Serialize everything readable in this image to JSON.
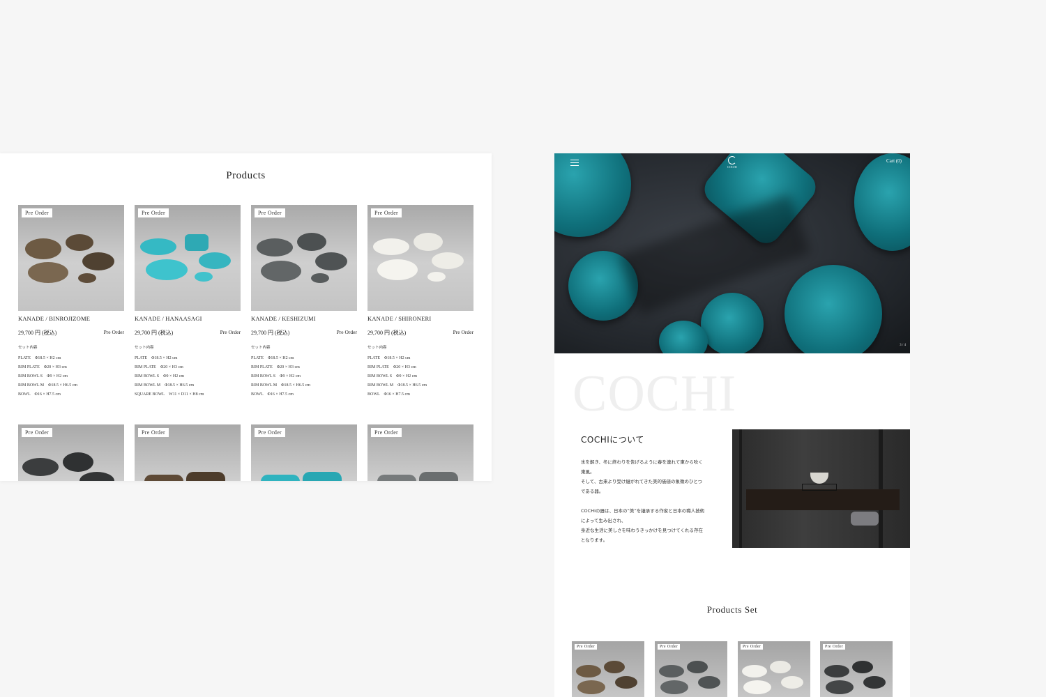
{
  "products_section": {
    "title": "Products",
    "items": [
      {
        "badge": "Pre Order",
        "name": "KANADE / BINROJIZOME",
        "price": "29,700 円 (税込)",
        "status": "Pre Order",
        "set_label": "セット内容",
        "specs": [
          "PLATE　Φ18.5 × H2 cm",
          "RIM PLATE　Φ20 × H3 cm",
          "RIM BOWL S　Φ9 × H2 cm",
          "RIM BOWL M　Φ18.5 × H6.5 cm",
          "BOWL　Φ16 × H7.5 cm"
        ],
        "color": "#6d5a43"
      },
      {
        "badge": "Pre Order",
        "name": "KANADE / HANAASAGI",
        "price": "29,700 円 (税込)",
        "status": "Pre Order",
        "set_label": "セット内容",
        "specs": [
          "PLATE　Φ18.5 × H2 cm",
          "RIM PLATE　Φ20 × H3 cm",
          "RIM BOWL S　Φ9 × H2 cm",
          "RIM BOWL M　Φ18.5 × H6.5 cm",
          "SQUARE BOWL　W11 × D11 × H8 cm"
        ],
        "color": "#35b9c4"
      },
      {
        "badge": "Pre Order",
        "name": "KANADE / KESHIZUMI",
        "price": "29,700 円 (税込)",
        "status": "Pre Order",
        "set_label": "セット内容",
        "specs": [
          "PLATE　Φ18.5 × H2 cm",
          "RIM PLATE　Φ20 × H3 cm",
          "RIM BOWL S　Φ9 × H2 cm",
          "RIM BOWL M　Φ18.5 × H6.5 cm",
          "BOWL　Φ16 × H7.5 cm"
        ],
        "color": "#5a5e5f"
      },
      {
        "badge": "Pre Order",
        "name": "KANADE / SHIRONERI",
        "price": "29,700 円 (税込)",
        "status": "Pre Order",
        "set_label": "セット内容",
        "specs": [
          "PLATE　Φ18.5 × H2 cm",
          "RIM PLATE　Φ20 × H3 cm",
          "RIM BOWL S　Φ9 × H2 cm",
          "RIM BOWL M　Φ18.5 × H6.5 cm",
          "BOWL　Φ16 × H7.5 cm"
        ],
        "color": "#efeee8"
      }
    ],
    "row2": [
      {
        "badge": "Pre Order",
        "color": "#3b3d3e"
      },
      {
        "badge": "Pre Order",
        "color": "#5e4a36"
      },
      {
        "badge": "Pre Order",
        "color": "#2fb3bf"
      },
      {
        "badge": "Pre Order",
        "color": "#777b7c"
      }
    ]
  },
  "mobile": {
    "cart": "Cart (0)",
    "slide_counter": "3 / 4",
    "logo_text": "COCHI",
    "big_text": "COCHI",
    "about_title": "COCHIについて",
    "about_paragraph1": [
      "氷を解き、冬に終わりを告げるように春を連れて東から吹く",
      "東風。",
      "そして、古来より受け継がれてきた美的価値の象徴のひとつ",
      "である器。"
    ],
    "about_paragraph2": [
      "COCHIの器は、日本の“美”を継承する作家と日本の職人技術",
      "によって生み出され、",
      "身近な生活に美しさを味わうきっかけを見つけてくれる存在",
      "となります。"
    ],
    "products_set_title": "Products Set",
    "set_cards": [
      {
        "badge": "Pre Order",
        "color": "#6d5a43"
      },
      {
        "badge": "Pre Order",
        "color": "#5a5e5f"
      },
      {
        "badge": "Pre Order",
        "color": "#efeee8"
      },
      {
        "badge": "Pre Order",
        "color": "#3b3d3e"
      }
    ]
  }
}
